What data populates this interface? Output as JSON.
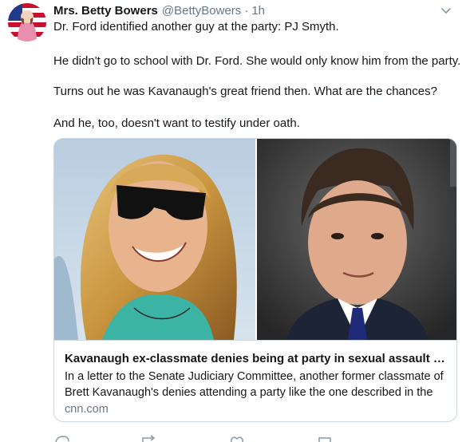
{
  "tweet": {
    "display_name": "Mrs. Betty Bowers",
    "handle": "@BettyBowers",
    "separator": "·",
    "time": "1h",
    "text_lines": [
      "Dr. Ford identified another guy at the party: PJ Smyth.",
      "He didn't go to school with Dr. Ford. She would only know him from the party.",
      "Turns out he was Kavanaugh's great friend then. What are the chances?",
      "And he, too, doesn't want to testify under oath."
    ]
  },
  "card": {
    "title": "Kavanaugh ex-classmate denies being at party in sexual assault alle...",
    "description_lines": [
      "In a letter to the Senate Judiciary Committee, another former classmate of",
      "Brett Kavanaugh's denies attending a party like the one described in the"
    ],
    "domain": "cnn.com"
  },
  "icons": {
    "caret": "chevron-down-icon",
    "reply": "reply-icon",
    "retweet": "retweet-icon",
    "like": "heart-icon",
    "share": "share-icon"
  },
  "colors": {
    "text": "#14171a",
    "secondary": "#657786",
    "border": "#ccd6dd"
  }
}
